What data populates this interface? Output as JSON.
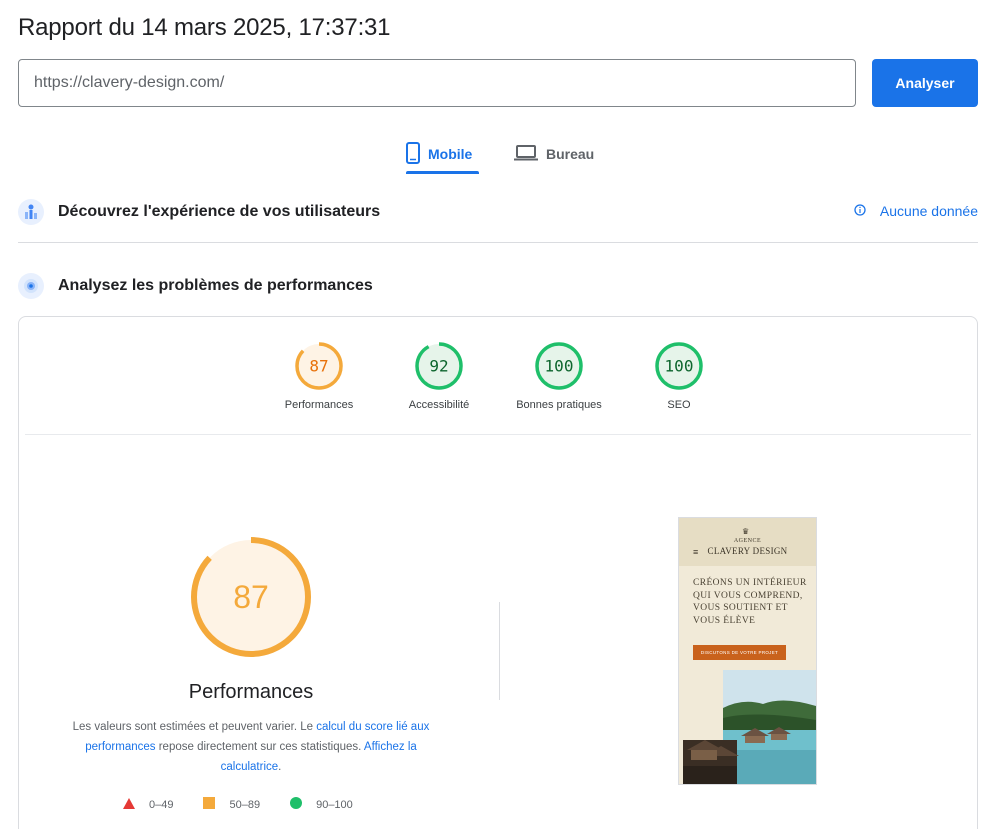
{
  "report": {
    "title": "Rapport du 14 mars 2025, 17:37:31"
  },
  "search": {
    "url": "https://clavery-design.com/",
    "analyze_label": "Analyser"
  },
  "tabs": [
    {
      "label": "Mobile",
      "icon": "smartphone-icon",
      "active": true
    },
    {
      "label": "Bureau",
      "icon": "laptop-icon",
      "active": false
    }
  ],
  "sections": {
    "experience": {
      "title": "Découvrez l'expérience de vos utilisateurs",
      "no_data": "Aucune donnée"
    },
    "diagnostics": {
      "title": "Analysez les problèmes de performances"
    }
  },
  "scores": [
    {
      "value": "87",
      "label": "Performances",
      "color": "#e8710a",
      "fill": "#fef3e5",
      "ring": "#f4a93b",
      "score": 87
    },
    {
      "value": "92",
      "label": "Accessibilité",
      "color": "#0d652d",
      "fill": "#e6f4ea",
      "ring": "#1fbf6a",
      "score": 92
    },
    {
      "value": "100",
      "label": "Bonnes pratiques",
      "color": "#0d652d",
      "fill": "#e6f4ea",
      "ring": "#1fbf6a",
      "score": 100
    },
    {
      "value": "100",
      "label": "SEO",
      "color": "#0d652d",
      "fill": "#e6f4ea",
      "ring": "#1fbf6a",
      "score": 100
    }
  ],
  "main_score": {
    "value": "87",
    "label": "Performances",
    "score": 87
  },
  "disclaimer": {
    "part1": "Les valeurs sont estimées et peuvent varier. Le ",
    "link1": "calcul du score lié aux performances",
    "part2": " repose directement sur ces statistiques. ",
    "link2": "Affichez la calculatrice",
    "part3": "."
  },
  "legend": [
    {
      "range": "0–49",
      "shape": "triangle",
      "color": "#e53935"
    },
    {
      "range": "50–89",
      "shape": "square",
      "color": "#f4a93b"
    },
    {
      "range": "90–100",
      "shape": "circle",
      "color": "#1fbf6a"
    }
  ],
  "preview": {
    "agence": "AGENCE",
    "brand": "CLAVERY DESIGN",
    "headline": "CRÉONS UN INTÉRIEUR QUI VOUS COMPREND, VOUS SOUTIENT ET VOUS ÉLÈVE",
    "cta": "DISCUTONS DE VOTRE PROJET"
  }
}
